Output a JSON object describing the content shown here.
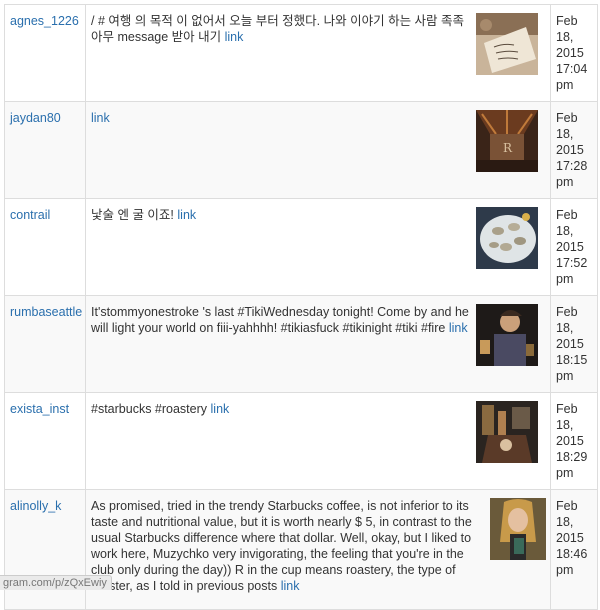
{
  "rows": [
    {
      "username": "agnes_1226",
      "message": "/ # 여행 의 목적 이 없어서 오늘 부터 정했다. 나와 이야기 하는 사람 족족 아무 message 받아 내기",
      "link": "link",
      "date": [
        "Feb",
        "18,",
        "2015",
        "17:04",
        "pm"
      ]
    },
    {
      "username": "jaydan80",
      "message": "",
      "link": "link",
      "date": [
        "Feb",
        "18,",
        "2015",
        "17:28",
        "pm"
      ]
    },
    {
      "username": "contrail",
      "message": "낯술 엔 굴 이죠!",
      "link": "link",
      "date": [
        "Feb",
        "18,",
        "2015",
        "17:52",
        "pm"
      ]
    },
    {
      "username": "rumbaseattle",
      "message": "It'stommyonestroke 's last #TikiWednesday tonight! Come by and he will light your world on fiii-yahhhh! #tikiasfuck #tikinight #tiki #fire",
      "link": "link",
      "date": [
        "Feb",
        "18,",
        "2015",
        "18:15",
        "pm"
      ]
    },
    {
      "username": "exista_inst",
      "message": "#starbucks #roastery",
      "link": "link",
      "date": [
        "Feb",
        "18,",
        "2015",
        "18:29",
        "pm"
      ]
    },
    {
      "username": "alinolly_k",
      "message": "As promised, tried in the trendy Starbucks coffee, is not inferior to its taste and nutritional value, but it is worth nearly $ 5, in contrast to the usual Starbucks difference where that dollar. Well, okay, but I liked to work here, Muzychko very invigorating, the feeling that you're in the club only during the day)) R in the cup means roastery, the type of roaster, as I told in previous posts",
      "link": "link",
      "date": [
        "Feb",
        "18,",
        "2015",
        "18:46",
        "pm"
      ]
    }
  ],
  "status_url": "gram.com/p/zQxEwiy"
}
